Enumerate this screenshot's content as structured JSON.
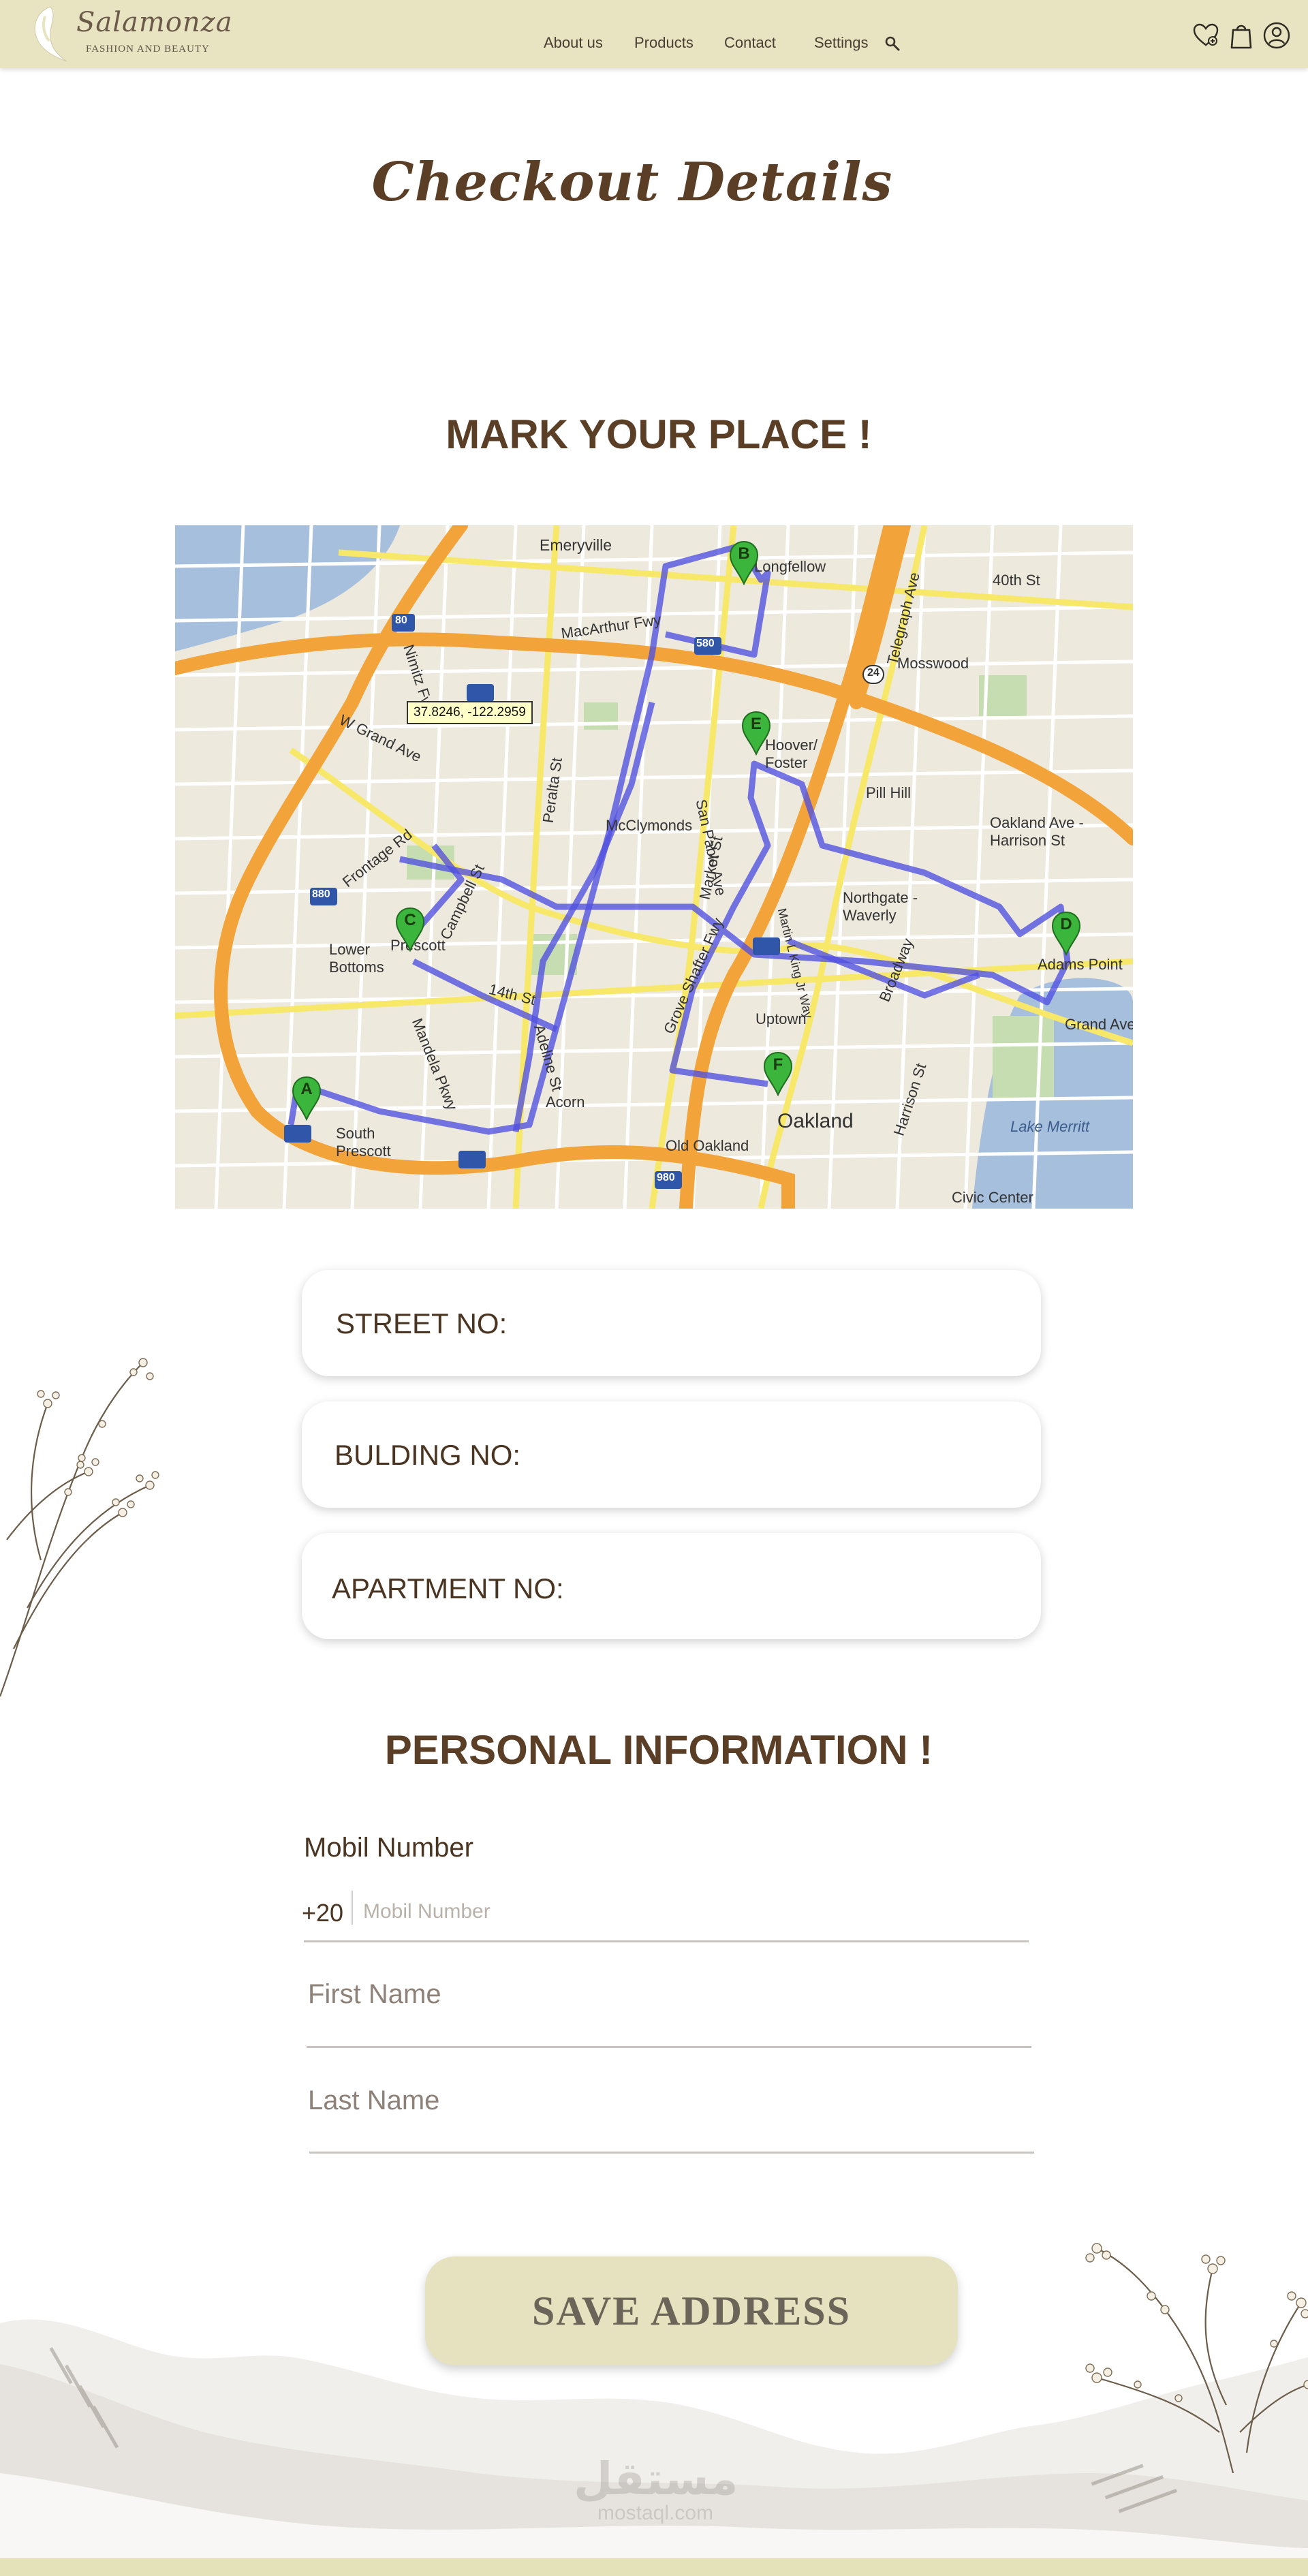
{
  "header": {
    "brand_name": "Salamonza",
    "brand_tagline": "FASHION AND BEAUTY",
    "nav": [
      "About us",
      "Products",
      "Contact",
      "Settings"
    ],
    "icons": {
      "search": "search-icon",
      "wishlist": "heart-icon",
      "cart": "shopping-bag-icon",
      "account": "user-icon"
    },
    "background": "#e8e4c2"
  },
  "page_title": "Checkout Details",
  "map_section": {
    "title": "MARK YOUR PLACE !",
    "coordinate_readout": "37.8246, -122.2959",
    "markers": [
      "A",
      "B",
      "C",
      "D",
      "E",
      "F"
    ],
    "place_labels": [
      "Emeryville",
      "Longfellow",
      "Mosswood",
      "Hoover/ Foster",
      "Pill Hill",
      "McClymonds",
      "Oakland Ave - Harrison St",
      "Northgate - Waverly",
      "Adams Point",
      "Lower Bottoms",
      "Prescott",
      "Uptown",
      "Oakland",
      "Acorn",
      "Old Oakland",
      "South Prescott",
      "Lake Merritt",
      "Civic Center",
      "Grand Ave"
    ],
    "street_labels": [
      "MacArthur Fwy",
      "Nimitz Fwy",
      "W Grand Ave",
      "40th St",
      "Telegraph Ave",
      "San Pablo Ave",
      "Market St",
      "14th St",
      "Harrison St",
      "Broadway",
      "Frontage Rd",
      "Campbell St",
      "Mandela Pkwy",
      "Adeline St",
      "Martin L King Jr Way",
      "Peralta St",
      "Grove Shafter Fwy"
    ],
    "highway_shields": [
      "80",
      "880",
      "580",
      "980",
      "24"
    ]
  },
  "address_fields": [
    {
      "label": "STREET NO:"
    },
    {
      "label": "BULDING NO:"
    },
    {
      "label": "APARTMENT NO:"
    }
  ],
  "personal_section": {
    "title": "PERSONAL INFORMATION  !",
    "mobile_label": "Mobil Number",
    "country_code": "+20",
    "mobile_placeholder": "Mobil Number",
    "first_name_placeholder": "First Name",
    "last_name_placeholder": "Last Name"
  },
  "save_button": "SAVE ADDRESS",
  "watermark": {
    "arabic": "مستقل",
    "latin": "mostaql.com"
  },
  "colors": {
    "accent": "#e8e4c2",
    "title_brown": "#5a3e26",
    "route_blue": "#4b4bdc",
    "marker_green": "#3cb53c",
    "footer": "#e4e2b8"
  }
}
